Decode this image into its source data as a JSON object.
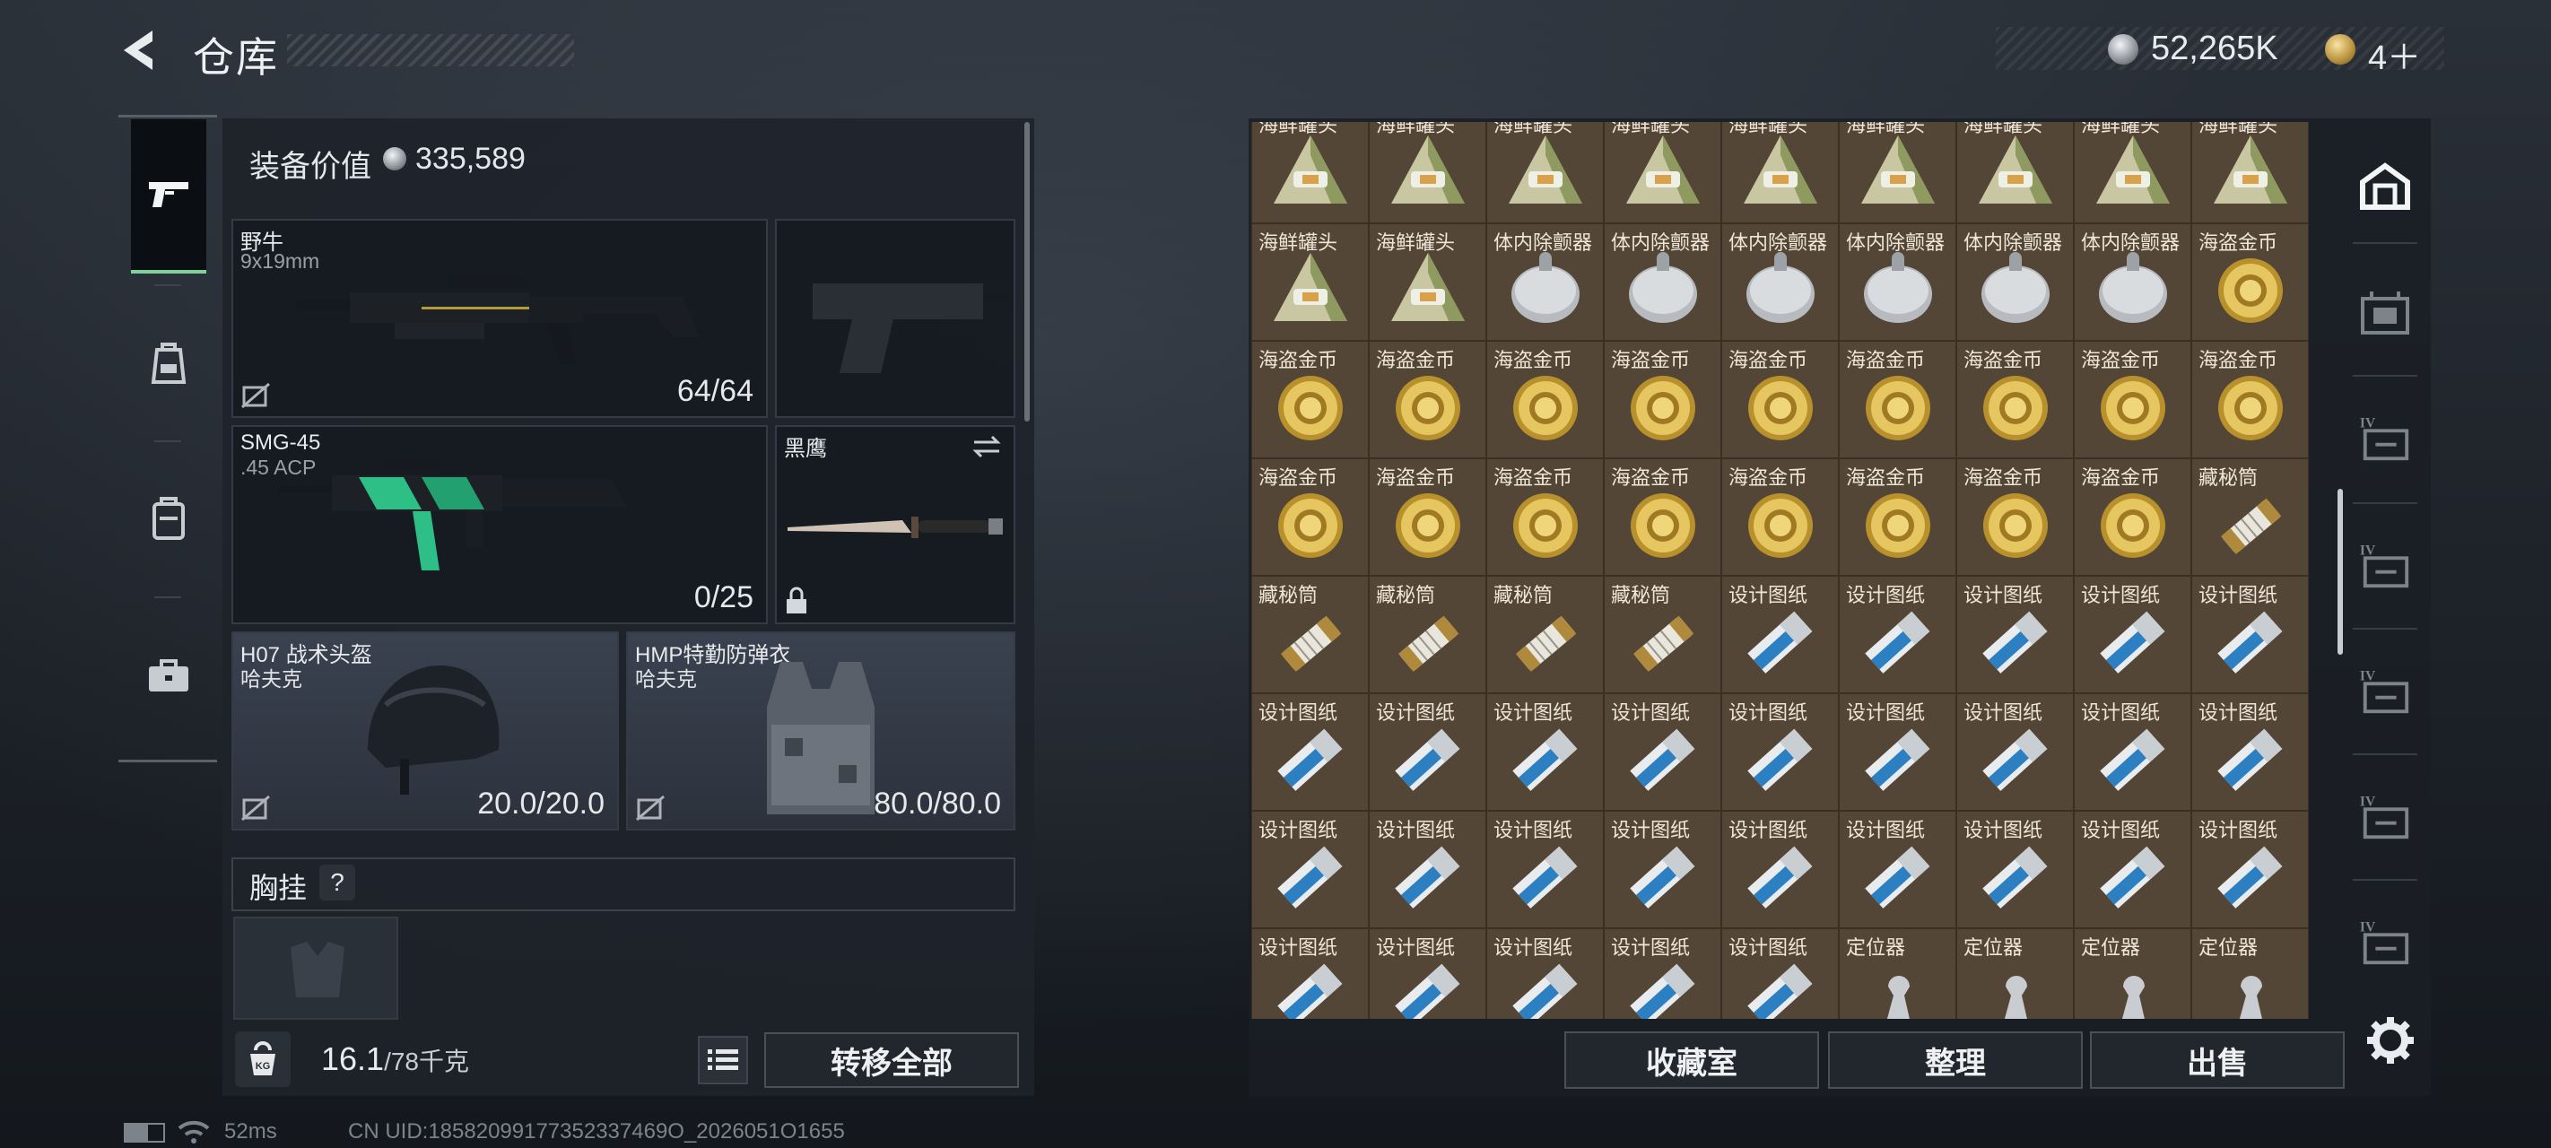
{
  "header": {
    "title": "仓库"
  },
  "currency": {
    "silver": "52,265K",
    "gold": "4＋"
  },
  "left_tabs": [
    {
      "name": "weapons",
      "active": true
    },
    {
      "name": "gear",
      "active": false
    },
    {
      "name": "backpack",
      "active": false
    },
    {
      "name": "toolbox",
      "active": false
    }
  ],
  "equipment": {
    "value_label": "装备价值",
    "value": "335,589",
    "primary": {
      "name": "野牛",
      "caliber": "9x19mm",
      "ammo": "64/64"
    },
    "secondary": {
      "name": "SMG-45",
      "caliber": ".45 ACP",
      "ammo": "0/25"
    },
    "melee": {
      "name": "黑鹰"
    },
    "helmet": {
      "name": "H07 战术头盔",
      "brand": "哈夫克",
      "durability": "20.0/20.0"
    },
    "vest": {
      "name": "HMP特勤防弹衣",
      "brand": "哈夫克",
      "durability": "80.0/80.0"
    },
    "chest_label": "胸挂",
    "chest_help": "?"
  },
  "footer_bar": {
    "weight_current": "16.1",
    "weight_max": "/78千克",
    "transfer_all": "转移全部",
    "kg_icon_text": "KG"
  },
  "stash": {
    "columns": 9,
    "items": [
      {
        "label": "海鲜罐头",
        "icon": "can"
      },
      {
        "label": "海鲜罐头",
        "icon": "can"
      },
      {
        "label": "海鲜罐头",
        "icon": "can"
      },
      {
        "label": "海鲜罐头",
        "icon": "can"
      },
      {
        "label": "海鲜罐头",
        "icon": "can"
      },
      {
        "label": "海鲜罐头",
        "icon": "can"
      },
      {
        "label": "海鲜罐头",
        "icon": "can"
      },
      {
        "label": "海鲜罐头",
        "icon": "can"
      },
      {
        "label": "海鲜罐头",
        "icon": "can"
      },
      {
        "label": "海鲜罐头",
        "icon": "can"
      },
      {
        "label": "海鲜罐头",
        "icon": "can"
      },
      {
        "label": "体内除颤器",
        "icon": "defib"
      },
      {
        "label": "体内除颤器",
        "icon": "defib"
      },
      {
        "label": "体内除颤器",
        "icon": "defib"
      },
      {
        "label": "体内除颤器",
        "icon": "defib"
      },
      {
        "label": "体内除颤器",
        "icon": "defib"
      },
      {
        "label": "体内除颤器",
        "icon": "defib"
      },
      {
        "label": "海盗金币",
        "icon": "coin"
      },
      {
        "label": "海盗金币",
        "icon": "coin"
      },
      {
        "label": "海盗金币",
        "icon": "coin"
      },
      {
        "label": "海盗金币",
        "icon": "coin"
      },
      {
        "label": "海盗金币",
        "icon": "coin"
      },
      {
        "label": "海盗金币",
        "icon": "coin"
      },
      {
        "label": "海盗金币",
        "icon": "coin"
      },
      {
        "label": "海盗金币",
        "icon": "coin"
      },
      {
        "label": "海盗金币",
        "icon": "coin"
      },
      {
        "label": "海盗金币",
        "icon": "coin"
      },
      {
        "label": "海盗金币",
        "icon": "coin"
      },
      {
        "label": "海盗金币",
        "icon": "coin"
      },
      {
        "label": "海盗金币",
        "icon": "coin"
      },
      {
        "label": "海盗金币",
        "icon": "coin"
      },
      {
        "label": "海盗金币",
        "icon": "coin"
      },
      {
        "label": "海盗金币",
        "icon": "coin"
      },
      {
        "label": "海盗金币",
        "icon": "coin"
      },
      {
        "label": "海盗金币",
        "icon": "coin"
      },
      {
        "label": "藏秘筒",
        "icon": "cylinder"
      },
      {
        "label": "藏秘筒",
        "icon": "cylinder"
      },
      {
        "label": "藏秘筒",
        "icon": "cylinder"
      },
      {
        "label": "藏秘筒",
        "icon": "cylinder"
      },
      {
        "label": "藏秘筒",
        "icon": "cylinder"
      },
      {
        "label": "设计图纸",
        "icon": "blueprint"
      },
      {
        "label": "设计图纸",
        "icon": "blueprint"
      },
      {
        "label": "设计图纸",
        "icon": "blueprint"
      },
      {
        "label": "设计图纸",
        "icon": "blueprint"
      },
      {
        "label": "设计图纸",
        "icon": "blueprint"
      },
      {
        "label": "设计图纸",
        "icon": "blueprint"
      },
      {
        "label": "设计图纸",
        "icon": "blueprint"
      },
      {
        "label": "设计图纸",
        "icon": "blueprint"
      },
      {
        "label": "设计图纸",
        "icon": "blueprint"
      },
      {
        "label": "设计图纸",
        "icon": "blueprint"
      },
      {
        "label": "设计图纸",
        "icon": "blueprint"
      },
      {
        "label": "设计图纸",
        "icon": "blueprint"
      },
      {
        "label": "设计图纸",
        "icon": "blueprint"
      },
      {
        "label": "设计图纸",
        "icon": "blueprint"
      },
      {
        "label": "设计图纸",
        "icon": "blueprint"
      },
      {
        "label": "设计图纸",
        "icon": "blueprint"
      },
      {
        "label": "设计图纸",
        "icon": "blueprint"
      },
      {
        "label": "设计图纸",
        "icon": "blueprint"
      },
      {
        "label": "设计图纸",
        "icon": "blueprint"
      },
      {
        "label": "设计图纸",
        "icon": "blueprint"
      },
      {
        "label": "设计图纸",
        "icon": "blueprint"
      },
      {
        "label": "设计图纸",
        "icon": "blueprint"
      },
      {
        "label": "设计图纸",
        "icon": "blueprint"
      },
      {
        "label": "设计图纸",
        "icon": "blueprint"
      },
      {
        "label": "设计图纸",
        "icon": "blueprint"
      },
      {
        "label": "设计图纸",
        "icon": "blueprint"
      },
      {
        "label": "设计图纸",
        "icon": "blueprint"
      },
      {
        "label": "设计图纸",
        "icon": "blueprint"
      },
      {
        "label": "定位器",
        "icon": "locator"
      },
      {
        "label": "定位器",
        "icon": "locator"
      },
      {
        "label": "定位器",
        "icon": "locator"
      },
      {
        "label": "定位器",
        "icon": "locator"
      }
    ]
  },
  "stash_actions": {
    "collection": "收藏室",
    "organize": "整理",
    "sell": "出售"
  },
  "right_tabs": [
    {
      "name": "warehouse-main",
      "label": ""
    },
    {
      "name": "storage-1",
      "label": ""
    },
    {
      "name": "storage-2",
      "label": "IV"
    },
    {
      "name": "storage-3",
      "label": "IV"
    },
    {
      "name": "storage-4",
      "label": "IV"
    },
    {
      "name": "storage-5",
      "label": "IV"
    },
    {
      "name": "storage-6",
      "label": "IV"
    }
  ],
  "status": {
    "ping": "52ms",
    "uid": "CN UID:18582099177352337469O_2026051O1655"
  },
  "colors": {
    "accent_green": "#7bd59a",
    "cell_bg": "#544636",
    "panel_bg": "#1e232a"
  }
}
